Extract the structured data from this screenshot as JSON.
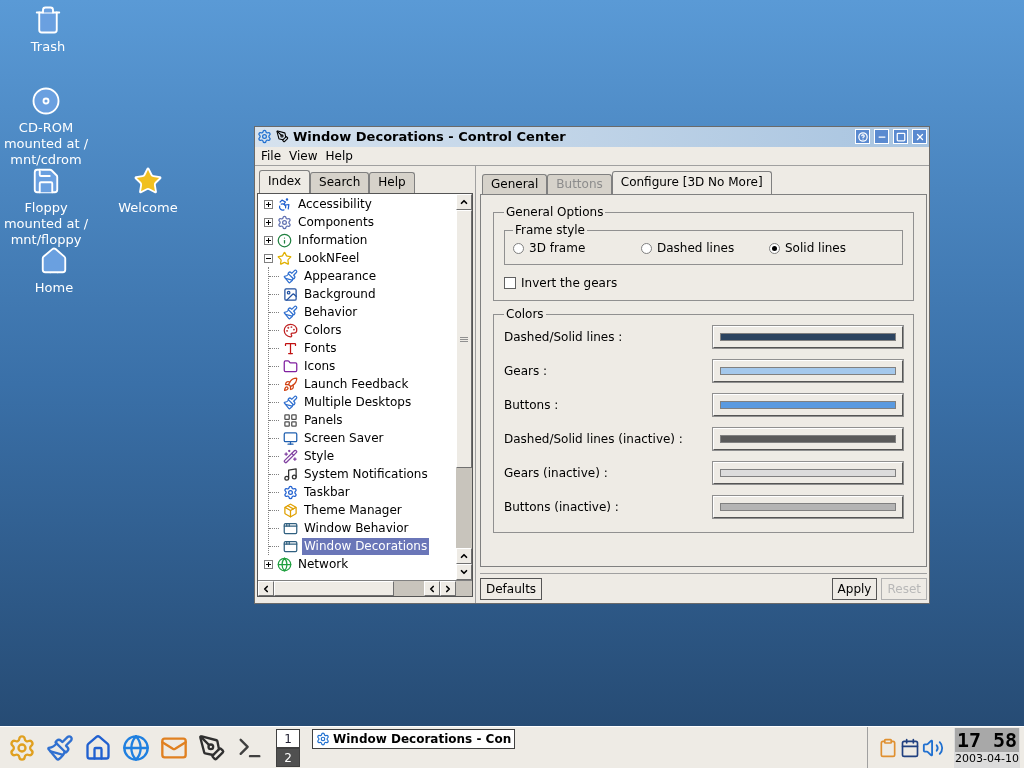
{
  "desktop_icons": [
    {
      "kind": "trash",
      "label": "Trash"
    },
    {
      "kind": "cdrom",
      "label": "CD-ROM mounted at / mnt/cdrom"
    },
    {
      "kind": "floppy",
      "label": "Floppy mounted at / mnt/floppy"
    },
    {
      "kind": "welcome",
      "label": "Welcome"
    },
    {
      "kind": "home",
      "label": "Home"
    }
  ],
  "window": {
    "title": "Window Decorations - Control Center",
    "menu": [
      "File",
      "View",
      "Help"
    ],
    "left_tabs": [
      {
        "label": "Index",
        "selected": true
      },
      {
        "label": "Search",
        "selected": false
      },
      {
        "label": "Help",
        "selected": false
      }
    ],
    "tree": [
      {
        "label": "Accessibility",
        "expanded": false,
        "selected": false
      },
      {
        "label": "Components",
        "expanded": false,
        "selected": false
      },
      {
        "label": "Information",
        "expanded": false,
        "selected": false
      },
      {
        "label": "LookNFeel",
        "expanded": true,
        "selected": false,
        "children": [
          {
            "label": "Appearance",
            "selected": false
          },
          {
            "label": "Background",
            "selected": false
          },
          {
            "label": "Behavior",
            "selected": false
          },
          {
            "label": "Colors",
            "selected": false
          },
          {
            "label": "Fonts",
            "selected": false
          },
          {
            "label": "Icons",
            "selected": false
          },
          {
            "label": "Launch Feedback",
            "selected": false
          },
          {
            "label": "Multiple Desktops",
            "selected": false
          },
          {
            "label": "Panels",
            "selected": false
          },
          {
            "label": "Screen Saver",
            "selected": false
          },
          {
            "label": "Style",
            "selected": false
          },
          {
            "label": "System Notifications",
            "selected": false
          },
          {
            "label": "Taskbar",
            "selected": false
          },
          {
            "label": "Theme Manager",
            "selected": false
          },
          {
            "label": "Window Behavior",
            "selected": false
          },
          {
            "label": "Window Decorations",
            "selected": true
          }
        ]
      },
      {
        "label": "Network",
        "expanded": false,
        "selected": false
      }
    ],
    "right_tabs": [
      {
        "label": "General",
        "selected": false,
        "disabled": false
      },
      {
        "label": "Buttons",
        "selected": false,
        "disabled": true
      },
      {
        "label": "Configure [3D No More]",
        "selected": true,
        "disabled": false
      }
    ],
    "general_options": {
      "title": "General Options",
      "frame_style": {
        "title": "Frame style",
        "options": [
          {
            "label": "3D frame",
            "selected": false
          },
          {
            "label": "Dashed lines",
            "selected": false
          },
          {
            "label": "Solid lines",
            "selected": true
          }
        ]
      },
      "checkbox": {
        "label": "Invert the gears",
        "checked": false
      }
    },
    "colors": {
      "title": "Colors",
      "rows": [
        {
          "label": "Dashed/Solid lines :",
          "color": "#2c4460"
        },
        {
          "label": "Gears :",
          "color": "#a4c8ec"
        },
        {
          "label": "Buttons :",
          "color": "#5a9ae0"
        },
        {
          "label": "Dashed/Solid lines (inactive) :",
          "color": "#5a5a5a"
        },
        {
          "label": "Gears (inactive) :",
          "color": "#dcdcdc"
        },
        {
          "label": "Buttons (inactive) :",
          "color": "#b4b4b4"
        }
      ]
    },
    "buttons": [
      {
        "label": "Defaults",
        "disabled": false
      },
      {
        "label": "Apply",
        "disabled": false
      },
      {
        "label": "Reset",
        "disabled": true
      }
    ]
  },
  "taskbar": {
    "pager": [
      {
        "label": "1",
        "selected": true
      },
      {
        "label": "2",
        "selected": false
      }
    ],
    "task": "Window Decorations - Con",
    "clock": {
      "time": "17 58",
      "date": "2003-04-10"
    }
  }
}
